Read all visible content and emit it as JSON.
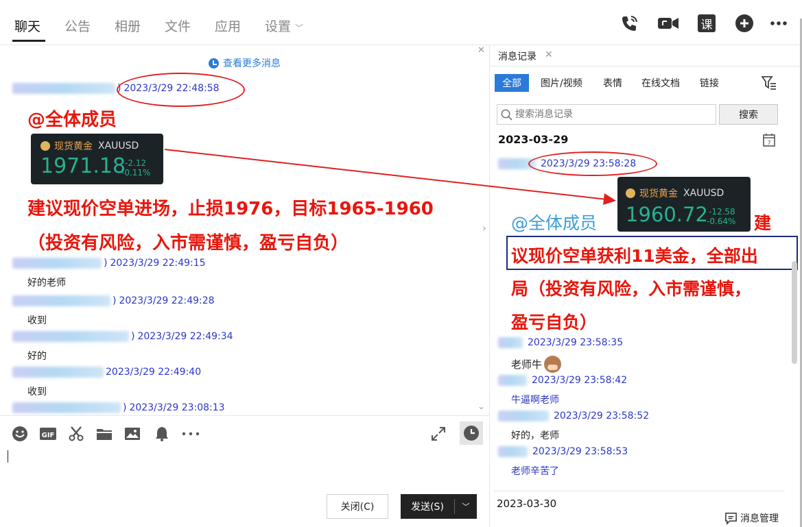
{
  "tabs": [
    {
      "label": "聊天",
      "active": true
    },
    {
      "label": "公告"
    },
    {
      "label": "相册"
    },
    {
      "label": "文件"
    },
    {
      "label": "应用"
    },
    {
      "label": "设置"
    }
  ],
  "toolbar": {
    "course_label": "课"
  },
  "chat": {
    "more_messages": "查看更多消息",
    "messages": [
      {
        "sender_suffix": ")",
        "time": "2023/3/29 22:48:58"
      },
      {
        "time": "2023/3/29 22:49:15",
        "text": "好的老师",
        "sender_suffix": ")"
      },
      {
        "time": "2023/3/29 22:49:28",
        "text": "收到",
        "sender_suffix": ")"
      },
      {
        "time": "2023/3/29 22:49:34",
        "text": "好的",
        "sender_suffix": ")"
      },
      {
        "time": "2023/3/29 22:49:40",
        "text": "收到",
        "sender_suffix": ""
      },
      {
        "time": "2023/3/29 23:08:13",
        "sender_suffix": ")"
      }
    ],
    "mention": "@全体成员",
    "advice_line1": "建议现价空单进场，止损1976，目标1965-1960",
    "advice_line2": "（投资有风险，入市需谨慎，盈亏自负）",
    "gold_card": {
      "name": "现货黄金",
      "symbol": "XAUUSD",
      "price": "1971.18",
      "change": "-2.12",
      "change_pct": "-0.11%"
    }
  },
  "composer": {
    "close_label": "关闭(C)",
    "send_label": "发送(S)"
  },
  "history": {
    "title": "消息记录",
    "filters": [
      "全部",
      "图片/视频",
      "表情",
      "在线文档",
      "链接"
    ],
    "search_placeholder": "搜索消息记录",
    "search_button": "搜索",
    "date1": "2023-03-29",
    "date2": "2023-03-30",
    "manage_label": "消息管理",
    "gold_card": {
      "name": "现货黄金",
      "symbol": "XAUUSD",
      "price": "1960.72",
      "change": "-12.58",
      "change_pct": "-0.64%"
    },
    "mention": "@全体成员",
    "line_jian": "建",
    "line1": "议现价空单获利11美金，全部出",
    "line2": "局（投资有风险，入市需谨慎，",
    "line3": "盈亏自负）",
    "messages": [
      {
        "time": "2023/3/29 23:58:28"
      },
      {
        "time": "2023/3/29 23:58:35",
        "text": "老师牛"
      },
      {
        "time": "2023/3/29 23:58:42",
        "text": "牛逼啊老师"
      },
      {
        "time": "2023/3/29 23:58:52",
        "text": "好的，老师"
      },
      {
        "time": "2023/3/29 23:58:53",
        "text": "老师辛苦了"
      }
    ]
  },
  "colors": {
    "red": "#e8160c",
    "blue_link": "#2a7ad9",
    "sender_blue": "#2a35c9",
    "gold_green": "#29b18f"
  }
}
